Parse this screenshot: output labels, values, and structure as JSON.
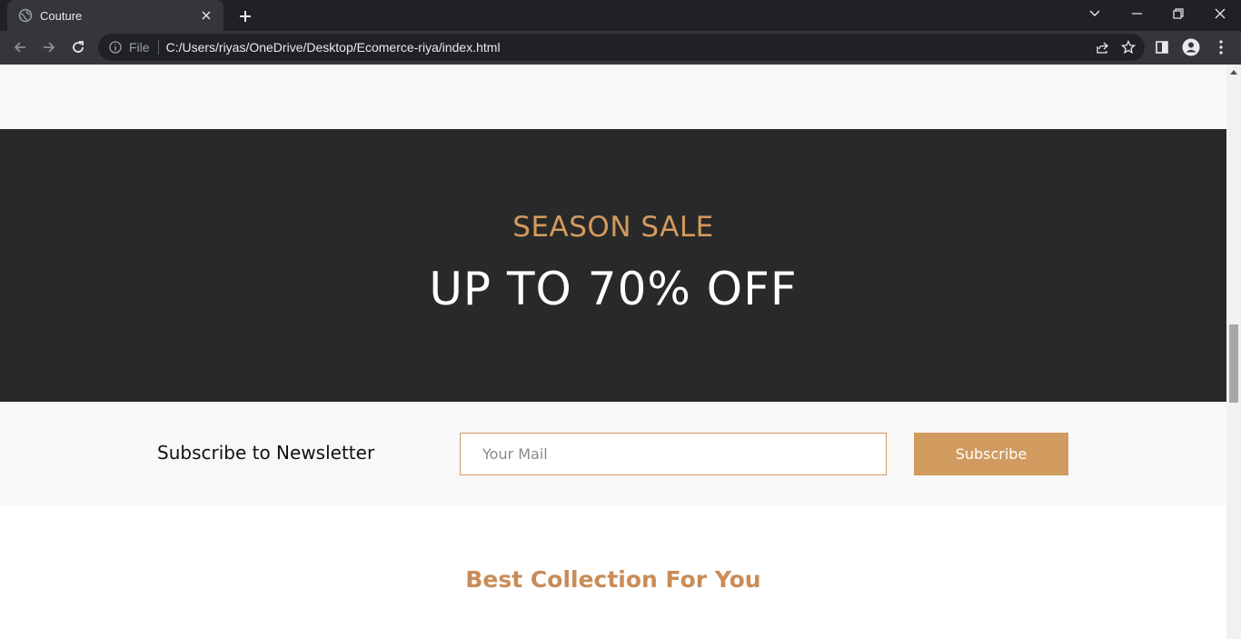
{
  "browser": {
    "tab": {
      "title": "Couture"
    },
    "omnibox": {
      "scheme": "File",
      "url": "C:/Users/riyas/OneDrive/Desktop/Ecomerce-riya/index.html"
    }
  },
  "page": {
    "sale": {
      "subtitle": "SEASON SALE",
      "headline": "UP TO 70% OFF"
    },
    "newsletter": {
      "label": "Subscribe to Newsletter",
      "input_placeholder": "Your Mail",
      "button_label": "Subscribe"
    },
    "collection": {
      "heading": "Best Collection For You"
    }
  },
  "colors": {
    "accent": "#d19a5e",
    "sale_bg": "#292929",
    "light_bg": "#f8f8f8"
  }
}
